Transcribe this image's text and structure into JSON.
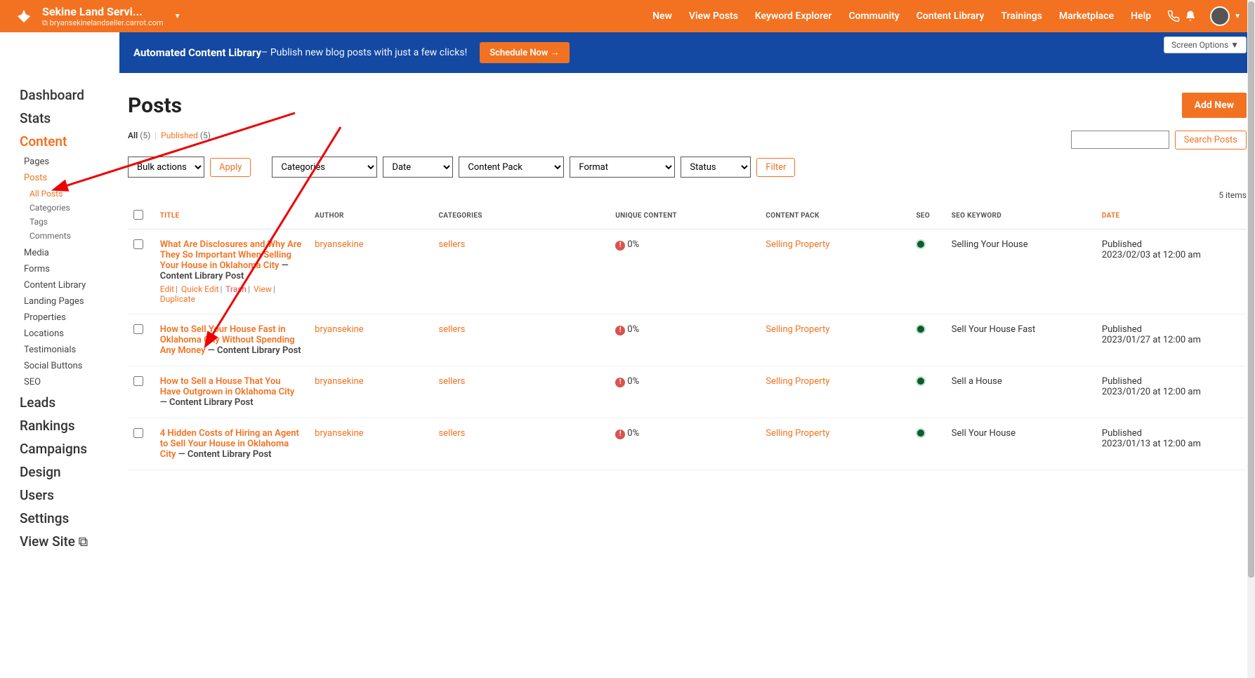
{
  "topbar": {
    "site_name": "Sekine Land Servi...",
    "site_url": "bryansekinelandseller.carrot.com",
    "menu": [
      "New",
      "View Posts",
      "Keyword Explorer",
      "Community",
      "Content Library",
      "Trainings",
      "Marketplace",
      "Help"
    ]
  },
  "banner": {
    "title": "Automated Content Library",
    "subtitle": " – Publish new blog posts with just a few clicks!",
    "button": "Schedule Now →",
    "screen_options": "Screen Options  ▼"
  },
  "sidebar": {
    "top": [
      "Dashboard",
      "Stats",
      "Content"
    ],
    "content_sub": [
      "Pages",
      "Posts"
    ],
    "posts_sub": [
      "All Posts",
      "Categories",
      "Tags",
      "Comments"
    ],
    "content_sub2": [
      "Media",
      "Forms",
      "Content Library",
      "Landing Pages",
      "Properties",
      "Locations",
      "Testimonials",
      "Social Buttons",
      "SEO"
    ],
    "bottom": [
      "Leads",
      "Rankings",
      "Campaigns",
      "Design",
      "Users",
      "Settings",
      "View Site ⧉"
    ]
  },
  "page": {
    "title": "Posts",
    "add_new": "Add New",
    "search_btn": "Search Posts"
  },
  "tabs": {
    "all_label": "All",
    "all_count": "(5)",
    "pub_label": "Published",
    "pub_count": "(5)"
  },
  "filters": {
    "bulk": "Bulk actions",
    "apply": "Apply",
    "categories": "Categories",
    "date": "Date",
    "content_pack": "Content Pack",
    "format": "Format",
    "status": "Status",
    "filter": "Filter"
  },
  "count": "5 items",
  "columns": {
    "title": "Title",
    "author": "Author",
    "categories": "Categories",
    "unique": "Unique Content",
    "cpack": "Content Pack",
    "seo": "SEO",
    "seokw": "SEO Keyword",
    "date": "Date"
  },
  "row_actions": {
    "edit": "Edit",
    "quick": "Quick Edit",
    "trash": "Trash",
    "view": "View",
    "dup": "Duplicate"
  },
  "rows": [
    {
      "title": "What Are Disclosures and Why Are They So Important When Selling Your House in Oklahoma City",
      "suffix": " — Content Library Post",
      "author": "bryansekine",
      "category": "sellers",
      "unique": "0%",
      "cpack": "Selling Property",
      "seokw": "Selling Your House",
      "date_status": "Published",
      "date_time": "2023/02/03 at 12:00 am",
      "show_actions": true
    },
    {
      "title": "How to Sell Your House Fast in Oklahoma City Without Spending Any Money",
      "suffix": " — Content Library Post",
      "author": "bryansekine",
      "category": "sellers",
      "unique": "0%",
      "cpack": "Selling Property",
      "seokw": "Sell Your House Fast",
      "date_status": "Published",
      "date_time": "2023/01/27 at 12:00 am",
      "show_actions": false
    },
    {
      "title": "How to Sell a House That You Have Outgrown in Oklahoma City",
      "suffix": " — Content Library Post",
      "author": "bryansekine",
      "category": "sellers",
      "unique": "0%",
      "cpack": "Selling Property",
      "seokw": "Sell a House",
      "date_status": "Published",
      "date_time": "2023/01/20 at 12:00 am",
      "show_actions": false
    },
    {
      "title": "4 Hidden Costs of Hiring an Agent to Sell Your House in Oklahoma City",
      "suffix": " — Content Library Post",
      "author": "bryansekine",
      "category": "sellers",
      "unique": "0%",
      "cpack": "Selling Property",
      "seokw": "Sell Your House",
      "date_status": "Published",
      "date_time": "2023/01/13 at 12:00 am",
      "show_actions": false
    }
  ]
}
